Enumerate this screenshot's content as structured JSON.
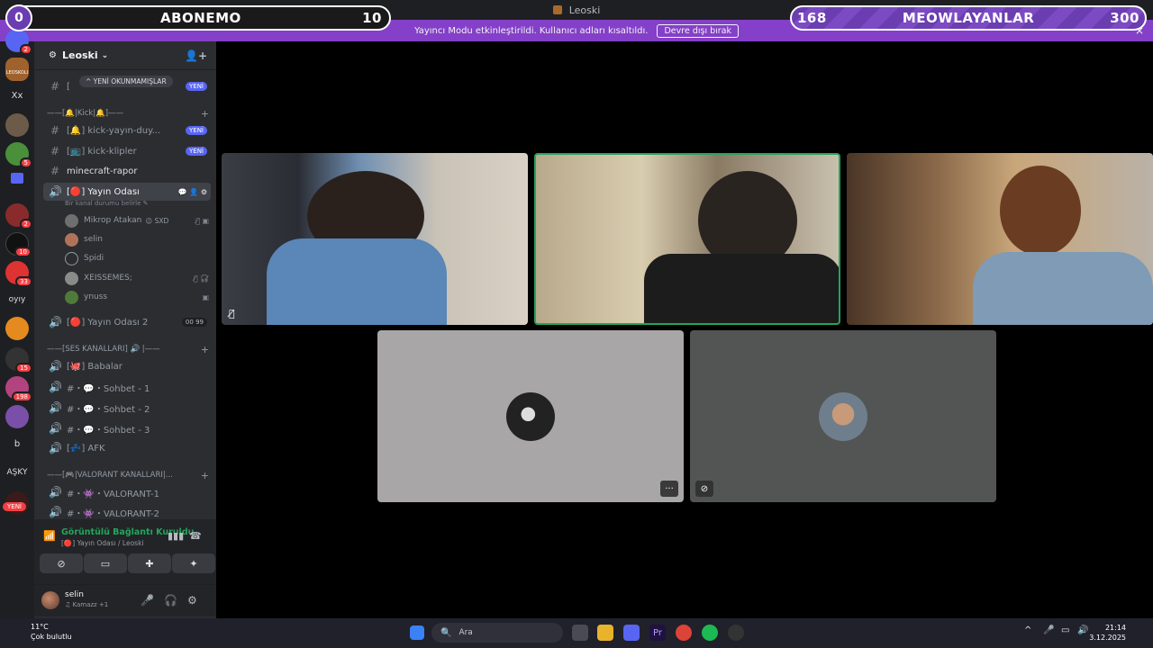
{
  "overlay": {
    "left": {
      "circle": "0",
      "label": "ABONEMO",
      "value": "10"
    },
    "right": {
      "circle": "168",
      "label": "MEOWLAYANLAR",
      "value": "300"
    }
  },
  "titlebar": {
    "title": "Leoski"
  },
  "notice": {
    "text": "Yayıncı Modu etkinleştirildi. Kullanıcı adları kısaltıldı.",
    "button": "Devre dışı bırak",
    "close": "×"
  },
  "rail": {
    "badges": [
      "2",
      "5",
      "2",
      "10",
      "33",
      "15",
      "198"
    ],
    "texts": [
      "Xx",
      "oyıy",
      "b",
      "AŞKY"
    ],
    "leoskoli": "LEOSKOLI",
    "new_label": "YENİ"
  },
  "server": {
    "name": "Leoski",
    "chevron": "⌄"
  },
  "unread_pill": "^ YENİ OKUNMAMIŞLAR",
  "channels": {
    "new_label": "YENİ",
    "c0": "[",
    "cat_kick": "——[🔔|Kick|🔔]——",
    "c1": "[🔔] kick-yayın-duy...",
    "c2": "[📺] kick-klipler",
    "c3": "minecraft-rapor",
    "c4": "[🔴] Yayın Odası",
    "c4_sub": "Bir kanal durumu belirle ✎",
    "users": [
      {
        "name": "Mikrop Atakan",
        "tag": "😉 SXD"
      },
      {
        "name": "selin",
        "tag": ""
      },
      {
        "name": "Spidi",
        "tag": ""
      },
      {
        "name": "XEISSEMES;",
        "tag": ""
      },
      {
        "name": "ynuss",
        "tag": ""
      }
    ],
    "c5": "[🔴] Yayın Odası 2",
    "c5_counts": [
      "00",
      "99"
    ],
    "cat_ses": "——[SES KANALLARI] 🔊 |——",
    "c6": "[🐙] Babalar",
    "c7": "#・💬・Sohbet - 1",
    "c8": "#・💬・Sohbet - 2",
    "c9": "#・💬・Sohbet - 3",
    "c10": "[💤] AFK",
    "cat_valo": "——[🎮|VALORANT KANALLARI|...",
    "c11": "#・👾・VALORANT-1",
    "c12": "#・👾・VALORANT-2"
  },
  "voice": {
    "status": "Görüntülü Bağlantı Kuruldu",
    "location": "[🔴] Yayın Odası / Leoski"
  },
  "me": {
    "name": "selin",
    "activity": "♫ Kamazz +1"
  },
  "taskbar": {
    "weather_temp": "11°C",
    "weather_desc": "Çok bulutlu",
    "search_placeholder": "Ara",
    "time": "21:14",
    "date": "3.12.2025"
  }
}
